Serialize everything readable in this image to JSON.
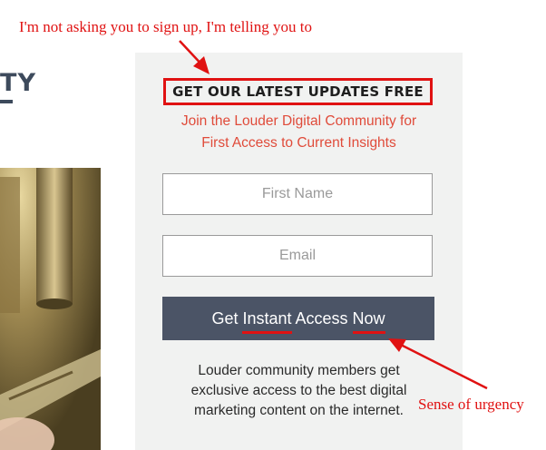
{
  "left_column": {
    "heading_fragment": "TY"
  },
  "signup_panel": {
    "title": "GET OUR LATEST UPDATES FREE",
    "subtitle_line1": "Join the Louder Digital Community for",
    "subtitle_line2": "First Access to Current Insights",
    "first_name_placeholder": "First Name",
    "email_placeholder": "Email",
    "cta": {
      "part1": "Get ",
      "part2": "Instant",
      "part3": " Access ",
      "part4": "Now"
    },
    "note_line1": "Louder community members get",
    "note_line2": "exclusive access to the best digital",
    "note_line3": "marketing content on the internet."
  },
  "annotations": {
    "top": "I'm not asking you to sign up, I'm telling you to",
    "urgency": "Sense of urgency"
  },
  "colors": {
    "annotation_red": "#e01212",
    "subtitle_red": "#e04b3a",
    "button_bg": "#4b5466",
    "panel_bg": "#f1f2f1",
    "heading_dark": "#3d4a5c"
  }
}
